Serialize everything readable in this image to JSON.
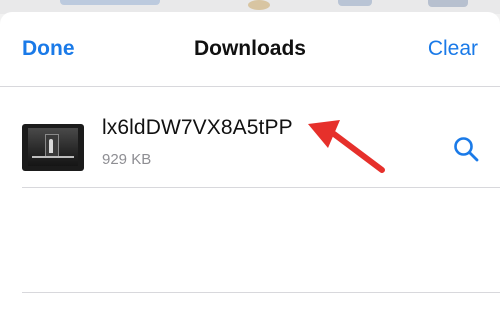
{
  "nav": {
    "done_label": "Done",
    "title": "Downloads",
    "clear_label": "Clear"
  },
  "downloads": [
    {
      "name": "lx6ldDW7VX8A5tPP",
      "size": "929 KB"
    }
  ],
  "colors": {
    "accent": "#1a7ae8",
    "annotation": "#e6302b"
  },
  "icons": {
    "row_action": "search-icon"
  }
}
